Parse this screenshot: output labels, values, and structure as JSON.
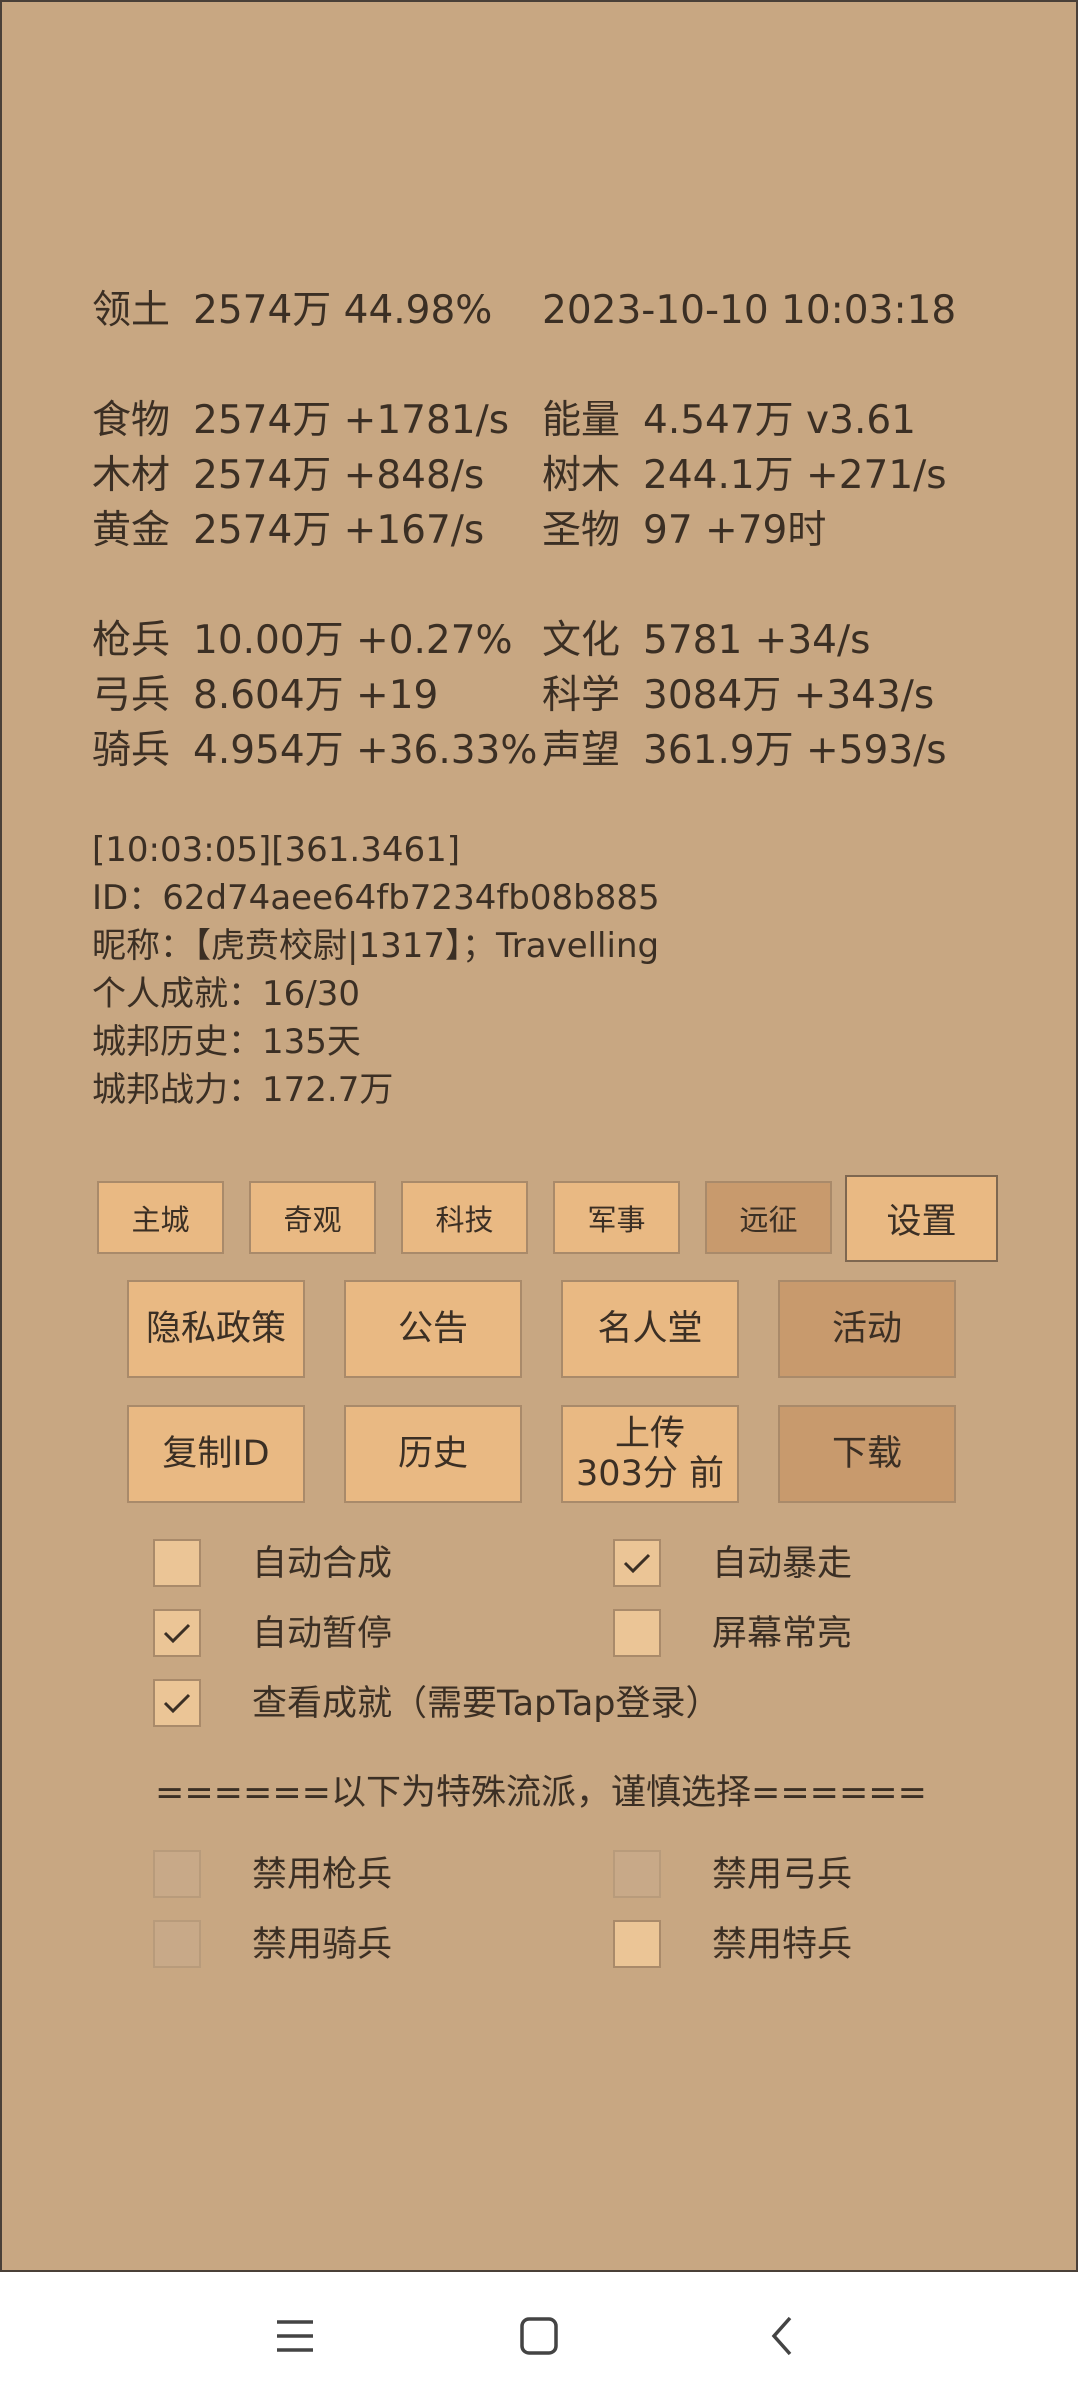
{
  "summary": {
    "territory_label": "领土",
    "territory_value": "2574万  44.98%",
    "datetime": "2023-10-10 10:03:18"
  },
  "resources_left": [
    {
      "label": "食物",
      "value": "2574万 +1781/s"
    },
    {
      "label": "木材",
      "value": "2574万 +848/s"
    },
    {
      "label": "黄金",
      "value": "2574万 +167/s"
    }
  ],
  "resources_right": [
    {
      "label": "能量",
      "value": "4.547万  v3.61"
    },
    {
      "label": "树木",
      "value": "244.1万 +271/s"
    },
    {
      "label": "圣物",
      "value": "97 +79时"
    }
  ],
  "troops_left": [
    {
      "label": "枪兵",
      "value": "10.00万 +0.27%"
    },
    {
      "label": "弓兵",
      "value": "8.604万 +19"
    },
    {
      "label": "骑兵",
      "value": "4.954万 +36.33%"
    }
  ],
  "stats_right": [
    {
      "label": "文化",
      "value": "5781 +34/s"
    },
    {
      "label": "科学",
      "value": "3084万 +343/s"
    },
    {
      "label": "声望",
      "value": "361.9万 +593/s"
    }
  ],
  "info": {
    "log_line": "[10:03:05][361.3461]",
    "id_line": "ID：62d74aee64fb7234fb08b885",
    "nickname_line": "昵称：【虎贲校尉|1317】；Travelling",
    "achievement_line": "个人成就：16/30",
    "history_line": "城邦历史：135天",
    "power_line": "城邦战力：172.7万"
  },
  "nav": {
    "main_city": "主城",
    "wonders": "奇观",
    "tech": "科技",
    "military": "军事",
    "expedition": "远征",
    "settings": "设置"
  },
  "buttons": {
    "privacy": "隐私政策",
    "notice": "公告",
    "hall_of_fame": "名人堂",
    "events": "活动",
    "copy_id": "复制ID",
    "history": "历史",
    "upload_line1": "上传",
    "upload_line2": "303分 前",
    "download": "下载"
  },
  "options": {
    "auto_merge": {
      "label": "自动合成",
      "checked": false
    },
    "auto_rampage": {
      "label": "自动暴走",
      "checked": true
    },
    "auto_pause": {
      "label": "自动暂停",
      "checked": true
    },
    "screen_on": {
      "label": "屏幕常亮",
      "checked": false
    },
    "view_achievements": {
      "label": "查看成就（需要TapTap登录）",
      "checked": true
    }
  },
  "special": {
    "warning": "======以下为特殊流派，谨慎选择======",
    "disable_spear": {
      "label": "禁用枪兵",
      "enabled": false
    },
    "disable_archer": {
      "label": "禁用弓兵",
      "enabled": false
    },
    "disable_cavalry": {
      "label": "禁用骑兵",
      "enabled": false
    },
    "disable_special": {
      "label": "禁用特兵",
      "enabled": true
    }
  },
  "icons": {
    "menu": "menu-icon",
    "home": "home-square-icon",
    "back": "back-chevron-icon"
  },
  "colors": {
    "background": "#c8a782",
    "button": "#e9b983",
    "button_dim": "#c89a6d",
    "text": "#3b2f24"
  }
}
